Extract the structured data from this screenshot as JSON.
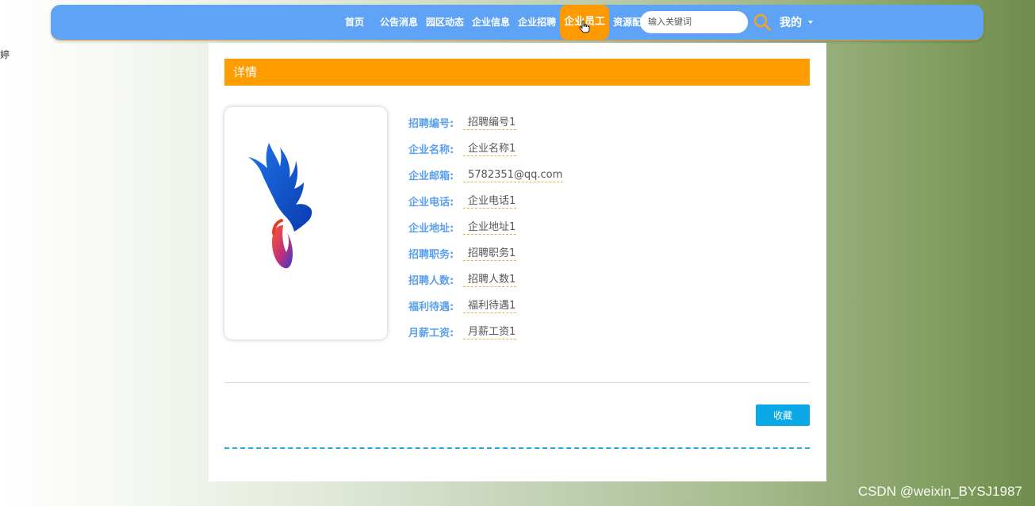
{
  "side_fragment": "婷",
  "nav": {
    "items": [
      "首页",
      "公告消息",
      "园区动态",
      "企业信息",
      "企业招聘",
      "企业员工",
      "资源配置"
    ],
    "active_index": 5,
    "search_placeholder": "输入关键词",
    "me_label": "我的"
  },
  "detail": {
    "header": "详情",
    "fields": [
      {
        "label": "招聘编号:",
        "value": "招聘编号1"
      },
      {
        "label": "企业名称:",
        "value": "企业名称1"
      },
      {
        "label": "企业邮箱:",
        "value": "5782351@qq.com"
      },
      {
        "label": "企业电话:",
        "value": "企业电话1"
      },
      {
        "label": "企业地址:",
        "value": "企业地址1"
      },
      {
        "label": "招聘职务:",
        "value": "招聘职务1"
      },
      {
        "label": "招聘人数:",
        "value": "招聘人数1"
      },
      {
        "label": "福利待遇:",
        "value": "福利待遇1"
      },
      {
        "label": "月薪工资:",
        "value": "月薪工资1"
      }
    ],
    "favorite_label": "收藏"
  },
  "watermark": "CSDN @weixin_BYSJ1987",
  "colors": {
    "nav_bg": "#5fa3f7",
    "accent_orange": "#ff9c00",
    "label_blue": "#5aa0ee",
    "button_blue": "#0aa8e6"
  },
  "icons": {
    "search": "search-icon",
    "logo": "phoenix-logo-icon",
    "dropdown": "chevron-down-icon"
  }
}
